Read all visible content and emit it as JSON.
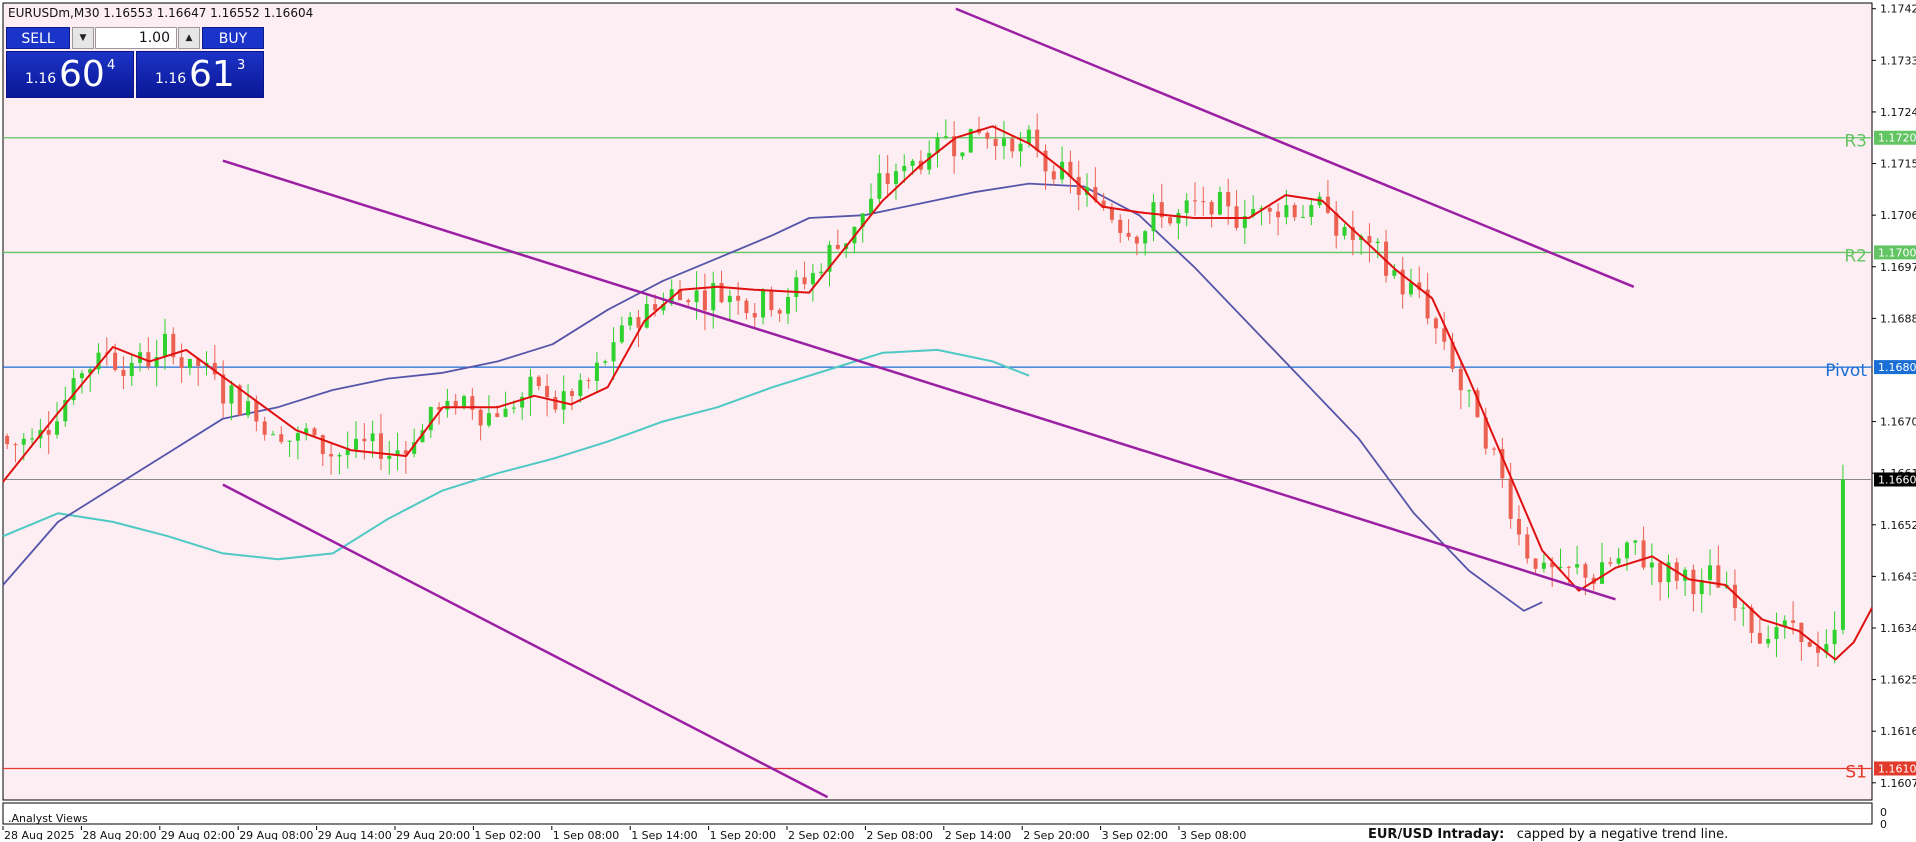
{
  "header": {
    "symbol_line": "EURUSDm,M30  1.16553 1.16647 1.16552 1.16604"
  },
  "trade_panel": {
    "sell_label": "SELL",
    "buy_label": "BUY",
    "lot": "1.00",
    "bid_big": "1.16",
    "bid_pips": "60",
    "bid_sup": "4",
    "ask_big": "1.16",
    "ask_pips": "61",
    "ask_sup": "3"
  },
  "footer": {
    "tab_label": ".Analyst Views",
    "analysis_title": "EUR/USD Intraday:",
    "analysis_text": "capped by a negative trend line.",
    "subwindow_axis_labels": [
      "0",
      "0"
    ]
  },
  "colors": {
    "background": "#fdeef3",
    "bull": "#2ed12e",
    "bear": "#ec6152",
    "ma_fast": "#e01010",
    "ma_mid": "#5555aa",
    "ma_slow": "#4fc9c4",
    "channel": "#9b1fa3",
    "resistance": "#62c462",
    "pivot": "#1a6fd6",
    "support": "#e23a2a",
    "current_price": "#888888"
  },
  "chart_data": {
    "type": "candlestick",
    "symbol": "EURUSDm",
    "timeframe": "M30",
    "last_price": 1.16604,
    "ylim": [
      1.16045,
      1.17435
    ],
    "y_ticks": [
      "1.17425",
      "1.17335",
      "1.17245",
      "1.17155",
      "1.17065",
      "1.16975",
      "1.16885",
      "1.16705",
      "1.16615",
      "1.16525",
      "1.16435",
      "1.16345",
      "1.16255",
      "1.16165",
      "1.16075"
    ],
    "x_ticks": [
      "28 Aug 2025",
      "28 Aug 20:00",
      "29 Aug 02:00",
      "29 Aug 08:00",
      "29 Aug 14:00",
      "29 Aug 20:00",
      "1 Sep 02:00",
      "1 Sep 08:00",
      "1 Sep 14:00",
      "1 Sep 20:00",
      "2 Sep 02:00",
      "2 Sep 08:00",
      "2 Sep 14:00",
      "2 Sep 20:00",
      "3 Sep 02:00",
      "3 Sep 08:00"
    ],
    "levels": [
      {
        "name": "R3",
        "price": 1.172,
        "label": "1.17200"
      },
      {
        "name": "R2",
        "price": 1.17,
        "label": "1.17000"
      },
      {
        "name": "Pivot",
        "price": 1.168,
        "label": "1.16800"
      },
      {
        "name": "S1",
        "price": 1.161,
        "label": "1.16100"
      }
    ],
    "current_label": "1.16604",
    "channel_lines": [
      {
        "x1": 0.0,
        "y1": 1.17425,
        "x2": 0.37,
        "y2": 1.1694
      },
      {
        "x1": -0.4,
        "y1": 1.1716,
        "x2": 0.36,
        "y2": 1.16395
      },
      {
        "x1": -0.4,
        "y1": 1.16595,
        "x2": -0.07,
        "y2": 1.1605
      }
    ],
    "ma_fast": [
      [
        -0.52,
        1.166
      ],
      [
        -0.49,
        1.1672
      ],
      [
        -0.46,
        1.16835
      ],
      [
        -0.44,
        1.1681
      ],
      [
        -0.42,
        1.1683
      ],
      [
        -0.39,
        1.1676
      ],
      [
        -0.36,
        1.1669
      ],
      [
        -0.33,
        1.16655
      ],
      [
        -0.3,
        1.16645
      ],
      [
        -0.28,
        1.1673
      ],
      [
        -0.25,
        1.1673
      ],
      [
        -0.23,
        1.1675
      ],
      [
        -0.21,
        1.16735
      ],
      [
        -0.19,
        1.16765
      ],
      [
        -0.17,
        1.1688
      ],
      [
        -0.15,
        1.16935
      ],
      [
        -0.13,
        1.1694
      ],
      [
        -0.11,
        1.16935
      ],
      [
        -0.08,
        1.1693
      ],
      [
        -0.06,
        1.1701
      ],
      [
        -0.04,
        1.1709
      ],
      [
        -0.02,
        1.1715
      ],
      [
        0.0,
        1.172
      ],
      [
        0.02,
        1.1722
      ],
      [
        0.04,
        1.1719
      ],
      [
        0.06,
        1.1714
      ],
      [
        0.08,
        1.1708
      ],
      [
        0.1,
        1.1707
      ],
      [
        0.13,
        1.1706
      ],
      [
        0.16,
        1.1706
      ],
      [
        0.18,
        1.171
      ],
      [
        0.2,
        1.1709
      ],
      [
        0.22,
        1.1703
      ],
      [
        0.24,
        1.1697
      ],
      [
        0.26,
        1.1692
      ],
      [
        0.28,
        1.1678
      ],
      [
        0.3,
        1.1663
      ],
      [
        0.32,
        1.1648
      ],
      [
        0.34,
        1.1641
      ],
      [
        0.36,
        1.1645
      ],
      [
        0.38,
        1.1647
      ],
      [
        0.4,
        1.1643
      ],
      [
        0.42,
        1.1642
      ],
      [
        0.44,
        1.1636
      ],
      [
        0.46,
        1.1634
      ],
      [
        0.48,
        1.1629
      ],
      [
        0.49,
        1.1632
      ],
      [
        0.5,
        1.1638
      ]
    ],
    "ma_mid": [
      [
        -0.52,
        1.1642
      ],
      [
        -0.49,
        1.1653
      ],
      [
        -0.46,
        1.1659
      ],
      [
        -0.43,
        1.1665
      ],
      [
        -0.4,
        1.1671
      ],
      [
        -0.37,
        1.1673
      ],
      [
        -0.34,
        1.1676
      ],
      [
        -0.31,
        1.1678
      ],
      [
        -0.28,
        1.1679
      ],
      [
        -0.25,
        1.1681
      ],
      [
        -0.22,
        1.1684
      ],
      [
        -0.19,
        1.169
      ],
      [
        -0.16,
        1.1695
      ],
      [
        -0.13,
        1.1699
      ],
      [
        -0.1,
        1.1703
      ],
      [
        -0.08,
        1.1706
      ],
      [
        -0.05,
        1.17065
      ],
      [
        -0.02,
        1.17085
      ],
      [
        0.01,
        1.17105
      ],
      [
        0.04,
        1.1712
      ],
      [
        0.07,
        1.17115
      ],
      [
        0.1,
        1.17065
      ],
      [
        0.13,
        1.16975
      ],
      [
        0.16,
        1.16875
      ],
      [
        0.19,
        1.16775
      ],
      [
        0.22,
        1.16675
      ],
      [
        0.25,
        1.16545
      ],
      [
        0.28,
        1.16445
      ],
      [
        0.31,
        1.16375
      ],
      [
        0.32,
        1.1639
      ]
    ],
    "ma_slow": [
      [
        -0.52,
        1.16505
      ],
      [
        -0.49,
        1.16545
      ],
      [
        -0.46,
        1.1653
      ],
      [
        -0.43,
        1.16505
      ],
      [
        -0.4,
        1.16475
      ],
      [
        -0.37,
        1.16465
      ],
      [
        -0.34,
        1.16475
      ],
      [
        -0.31,
        1.16535
      ],
      [
        -0.28,
        1.16585
      ],
      [
        -0.25,
        1.16615
      ],
      [
        -0.22,
        1.1664
      ],
      [
        -0.19,
        1.1667
      ],
      [
        -0.16,
        1.16705
      ],
      [
        -0.13,
        1.1673
      ],
      [
        -0.1,
        1.16765
      ],
      [
        -0.07,
        1.16795
      ],
      [
        -0.04,
        1.16825
      ],
      [
        -0.01,
        1.1683
      ],
      [
        0.02,
        1.1681
      ],
      [
        0.04,
        1.16785
      ]
    ]
  }
}
